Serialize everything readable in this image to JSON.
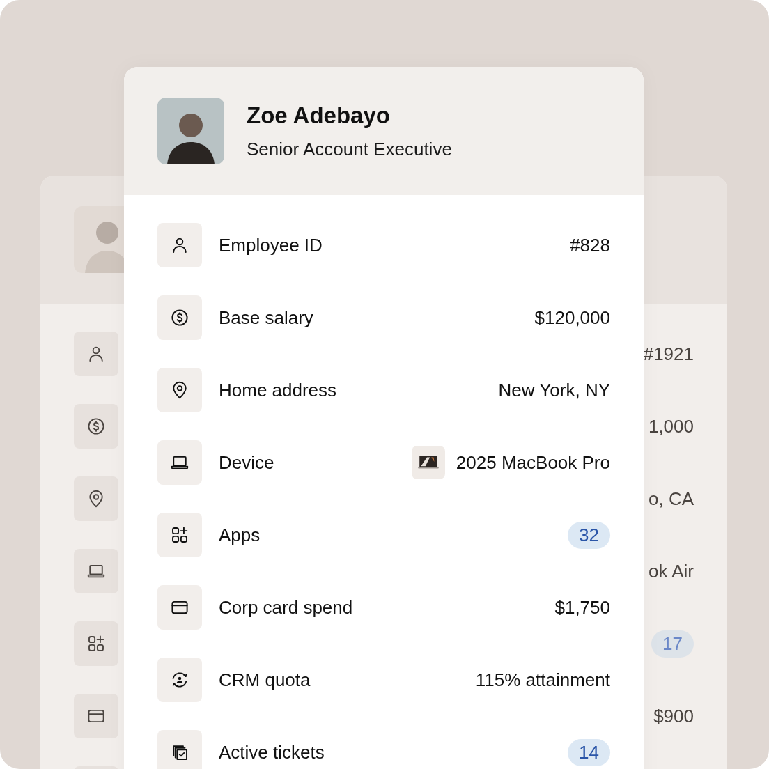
{
  "back_card": {
    "rows": [
      {
        "kind": "text",
        "value": "#1921"
      },
      {
        "kind": "text",
        "value": "1,000"
      },
      {
        "kind": "text",
        "value": "o, CA"
      },
      {
        "kind": "text",
        "value": "ok Air"
      },
      {
        "kind": "badge",
        "value": "17"
      },
      {
        "kind": "text",
        "value": "$900"
      }
    ]
  },
  "profile": {
    "name": "Zoe Adebayo",
    "title": "Senior Account Executive"
  },
  "rows": [
    {
      "label": "Employee ID",
      "kind": "text",
      "value": "#828"
    },
    {
      "label": "Base salary",
      "kind": "text",
      "value": "$120,000"
    },
    {
      "label": "Home address",
      "kind": "text",
      "value": "New York, NY"
    },
    {
      "label": "Device",
      "kind": "device",
      "value": "2025 MacBook Pro"
    },
    {
      "label": "Apps",
      "kind": "badge",
      "value": "32"
    },
    {
      "label": "Corp card spend",
      "kind": "text",
      "value": "$1,750"
    },
    {
      "label": "CRM quota",
      "kind": "text",
      "value": "115% attainment"
    },
    {
      "label": "Active tickets",
      "kind": "badge",
      "value": "14"
    }
  ]
}
